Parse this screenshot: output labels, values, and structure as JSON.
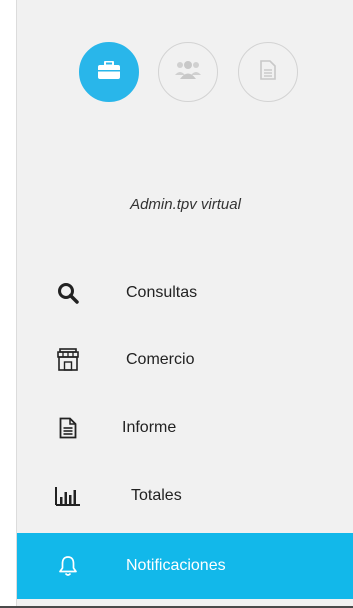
{
  "header": {
    "modes": [
      {
        "icon": "briefcase-icon",
        "active": true
      },
      {
        "icon": "users-icon",
        "active": false
      },
      {
        "icon": "document-icon",
        "active": false
      }
    ],
    "profile_label": "Admin.tpv virtual"
  },
  "menu": {
    "items": [
      {
        "label": "Consultas",
        "icon": "search-icon"
      },
      {
        "label": "Comercio",
        "icon": "store-icon"
      },
      {
        "label": "Informe",
        "icon": "report-icon"
      },
      {
        "label": "Totales",
        "icon": "bar-chart-icon"
      },
      {
        "label": "Notificaciones",
        "icon": "bell-icon",
        "active": true
      }
    ]
  },
  "colors": {
    "accent": "#12b8ea",
    "sidebar_bg": "#f1f1f1"
  }
}
